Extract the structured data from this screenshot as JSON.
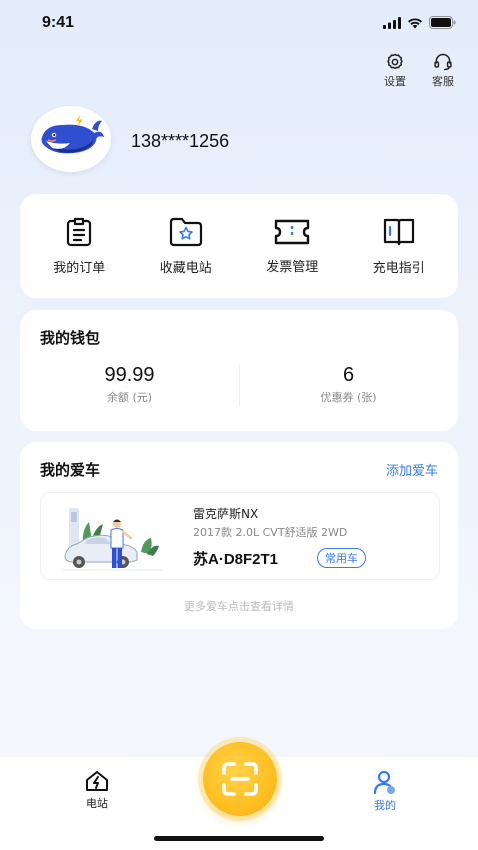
{
  "status_bar": {
    "time": "9:41"
  },
  "top_actions": {
    "settings_label": "设置",
    "service_label": "客服"
  },
  "user": {
    "phone": "138****1256"
  },
  "menu": [
    {
      "label": "我的订单",
      "icon": "order-icon"
    },
    {
      "label": "收藏电站",
      "icon": "favorite-station-icon"
    },
    {
      "label": "发票管理",
      "icon": "invoice-icon"
    },
    {
      "label": "充电指引",
      "icon": "guide-icon"
    }
  ],
  "wallet": {
    "title": "我的钱包",
    "balance_value": "99.99",
    "balance_label": "余额 (元)",
    "coupon_value": "6",
    "coupon_label": "优惠券 (张)"
  },
  "cars": {
    "title": "我的爱车",
    "add_label": "添加爱车",
    "item": {
      "model": "雷克萨斯NX",
      "spec": "2017款 2.0L CVT舒适版 2WD",
      "plate": "苏A·D8F2T1",
      "badge": "常用车"
    },
    "more_hint": "更多爱车点击查看详情"
  },
  "tabs": {
    "station_label": "电站",
    "mine_label": "我的"
  },
  "colors": {
    "accent": "#3a7bea",
    "scan": "#fdbb1c",
    "background": "#eef3fc"
  }
}
